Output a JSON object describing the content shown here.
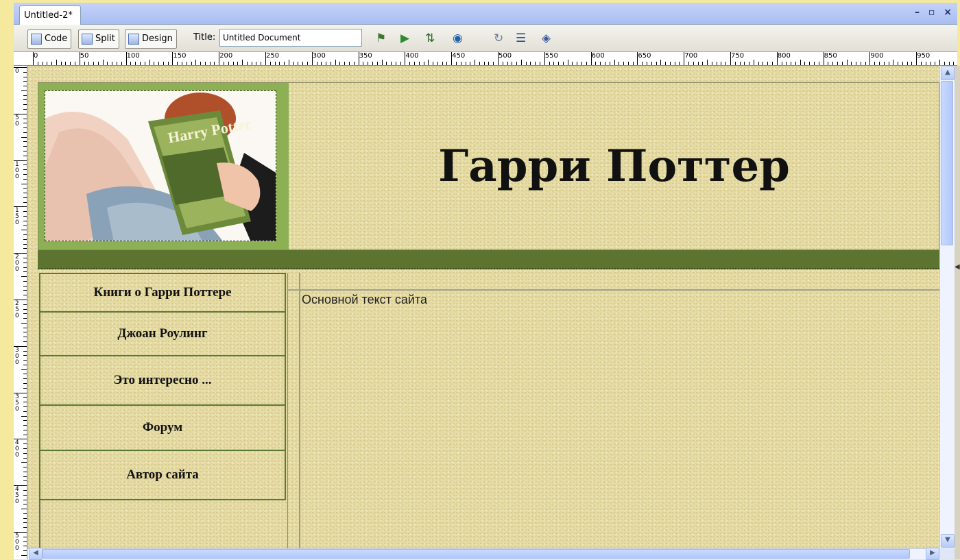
{
  "window": {
    "doc_tab": "Untitled-2*",
    "controls": "– ▫ ×"
  },
  "toolbar": {
    "code_label": "Code",
    "split_label": "Split",
    "design_label": "Design",
    "title_label": "Title:",
    "title_value": "Untitled Document"
  },
  "ruler": {
    "horizontal": [
      "0",
      "50",
      "100",
      "150",
      "200",
      "250",
      "300",
      "350",
      "400",
      "450",
      "500",
      "550",
      "600",
      "650",
      "700",
      "750",
      "800",
      "850",
      "900",
      "950"
    ],
    "vertical": [
      "0",
      "50",
      "100",
      "150",
      "200",
      "250",
      "300",
      "350",
      "400",
      "450",
      "500"
    ]
  },
  "page": {
    "site_title": "Гарри Поттер",
    "book_cover_text": "Harry Potter",
    "nav_items": [
      "Книги о Гарри Поттере",
      "Джоан Роулинг",
      "Это интересно ...",
      "Форум",
      "Автор сайта"
    ],
    "content_text": "Основной текст сайта"
  },
  "colors": {
    "page_bg": "#f4e99c",
    "header_green": "#8db055",
    "bar_green": "#5d7431",
    "nav_border": "#5c7a35"
  }
}
